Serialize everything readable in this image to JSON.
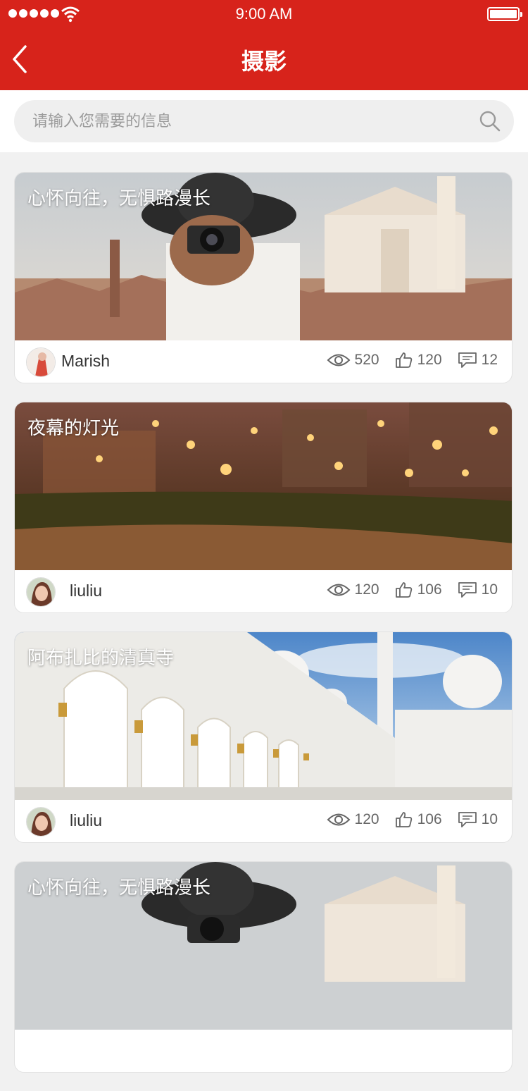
{
  "statusbar": {
    "time": "9:00 AM"
  },
  "navbar": {
    "title": "摄影"
  },
  "search": {
    "placeholder": "请输入您需要的信息"
  },
  "posts": [
    {
      "caption": "心怀向往，无惧路漫长",
      "author": "Marish",
      "views": "520",
      "likes": "120",
      "comments": "12"
    },
    {
      "caption": "夜幕的灯光",
      "author": "liuliu",
      "views": "120",
      "likes": "106",
      "comments": "10"
    },
    {
      "caption": "阿布扎比的清真寺",
      "author": "liuliu",
      "views": "120",
      "likes": "106",
      "comments": "10"
    },
    {
      "caption": "心怀向往，无惧路漫长"
    }
  ],
  "colors": {
    "brand": "#d7231b"
  }
}
